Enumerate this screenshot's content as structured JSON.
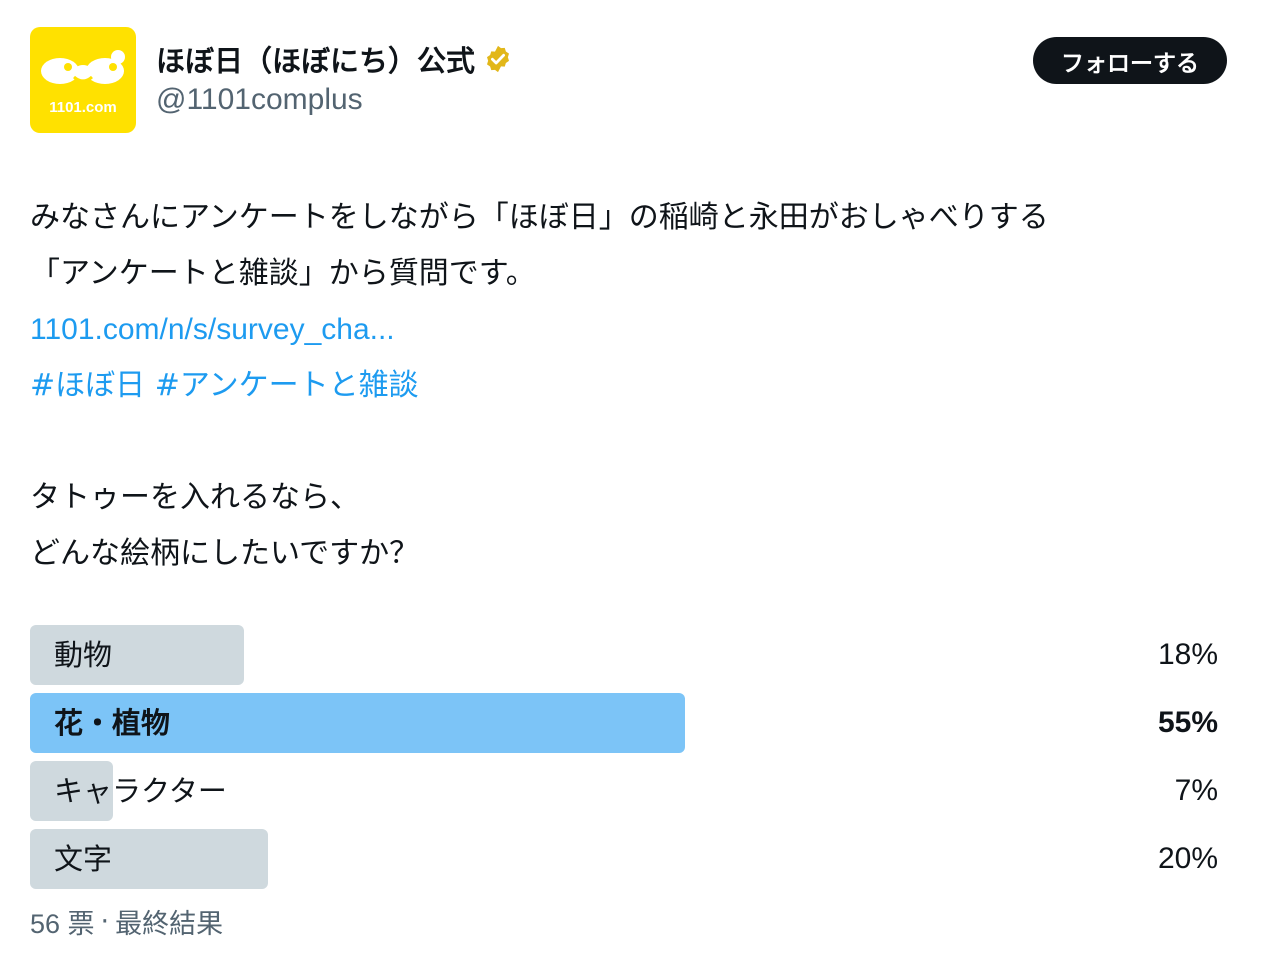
{
  "header": {
    "display_name": "ほぼ日（ほぼにち）公式",
    "handle": "@1101complus",
    "avatar_caption": "1101.com",
    "follow_label": "フォローする",
    "colors": {
      "avatar_bg": "#ffe100",
      "verified_badge": "#e2b719",
      "follow_bg": "#0f1419"
    }
  },
  "tweet": {
    "line1": "みなさんにアンケートをしながら「ほぼ日」の稲崎と永田がおしゃべりする",
    "line2": "「アンケートと雑談」から質問です。",
    "link": "1101.com/n/s/survey_cha...",
    "hashtag1": "#ほぼ日",
    "hashtag2": "#アンケートと雑談",
    "question_line1": "タトゥーを入れるなら、",
    "question_line2": "どんな絵柄にしたいですか？",
    "colors": {
      "link": "#1d9bf0",
      "text": "#0f1419"
    }
  },
  "poll": {
    "options": [
      {
        "label": "動物",
        "percent": 18,
        "percent_text": "18%",
        "winner": false
      },
      {
        "label": "花・植物",
        "percent": 55,
        "percent_text": "55%",
        "winner": true
      },
      {
        "label": "キャラクター",
        "percent": 7,
        "percent_text": "7%",
        "winner": false
      },
      {
        "label": "文字",
        "percent": 20,
        "percent_text": "20%",
        "winner": false
      }
    ],
    "votes": "56 票",
    "separator": "·",
    "status": "最終結果",
    "colors": {
      "bar": "#cfd9de",
      "winner_bar": "#7cc4f7"
    }
  }
}
